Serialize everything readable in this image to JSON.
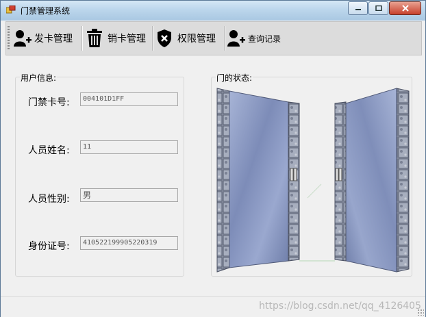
{
  "window": {
    "title": "门禁管理系统"
  },
  "toolbar": {
    "items": [
      {
        "label": "发卡管理",
        "icon": "add-user-icon"
      },
      {
        "label": "销卡管理",
        "icon": "trash-icon"
      },
      {
        "label": "权限管理",
        "icon": "shield-icon"
      },
      {
        "label": "查询记录",
        "icon": "add-user-icon"
      }
    ]
  },
  "user_info": {
    "title": "用户信息:",
    "fields": [
      {
        "label": "门禁卡号:",
        "value": "004101D1FF"
      },
      {
        "label": "人员姓名:",
        "value": "11"
      },
      {
        "label": "人员性别:",
        "value": "男"
      },
      {
        "label": "身份证号:",
        "value": "410522199905220319"
      }
    ]
  },
  "door_status": {
    "title": "门的状态:",
    "state": "open"
  },
  "statusbar": {
    "watermark": "https://blog.csdn.net/qq_4126405"
  },
  "colors": {
    "titlebar": "#bcd6ec",
    "toolbar": "#dcdcdc",
    "background": "#f0f0f0",
    "glass": "#8f9fc8",
    "close": "#c8412d"
  }
}
